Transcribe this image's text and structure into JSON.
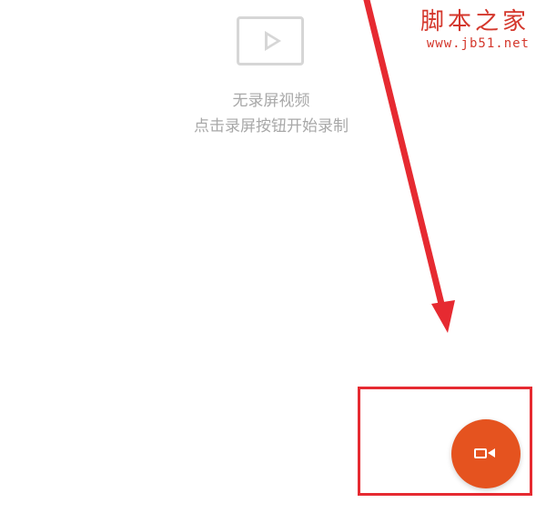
{
  "watermark": {
    "title": "脚本之家",
    "url": "www.jb51.net"
  },
  "empty_state": {
    "icon": "play-video-icon",
    "title": "无录屏视频",
    "hint": "点击录屏按钮开始录制"
  },
  "record_button": {
    "icon": "video-camera-icon"
  },
  "colors": {
    "accent": "#e5531f",
    "annotation": "#e62a31",
    "watermark": "#d4372c",
    "muted_text": "#a8a8a8"
  }
}
